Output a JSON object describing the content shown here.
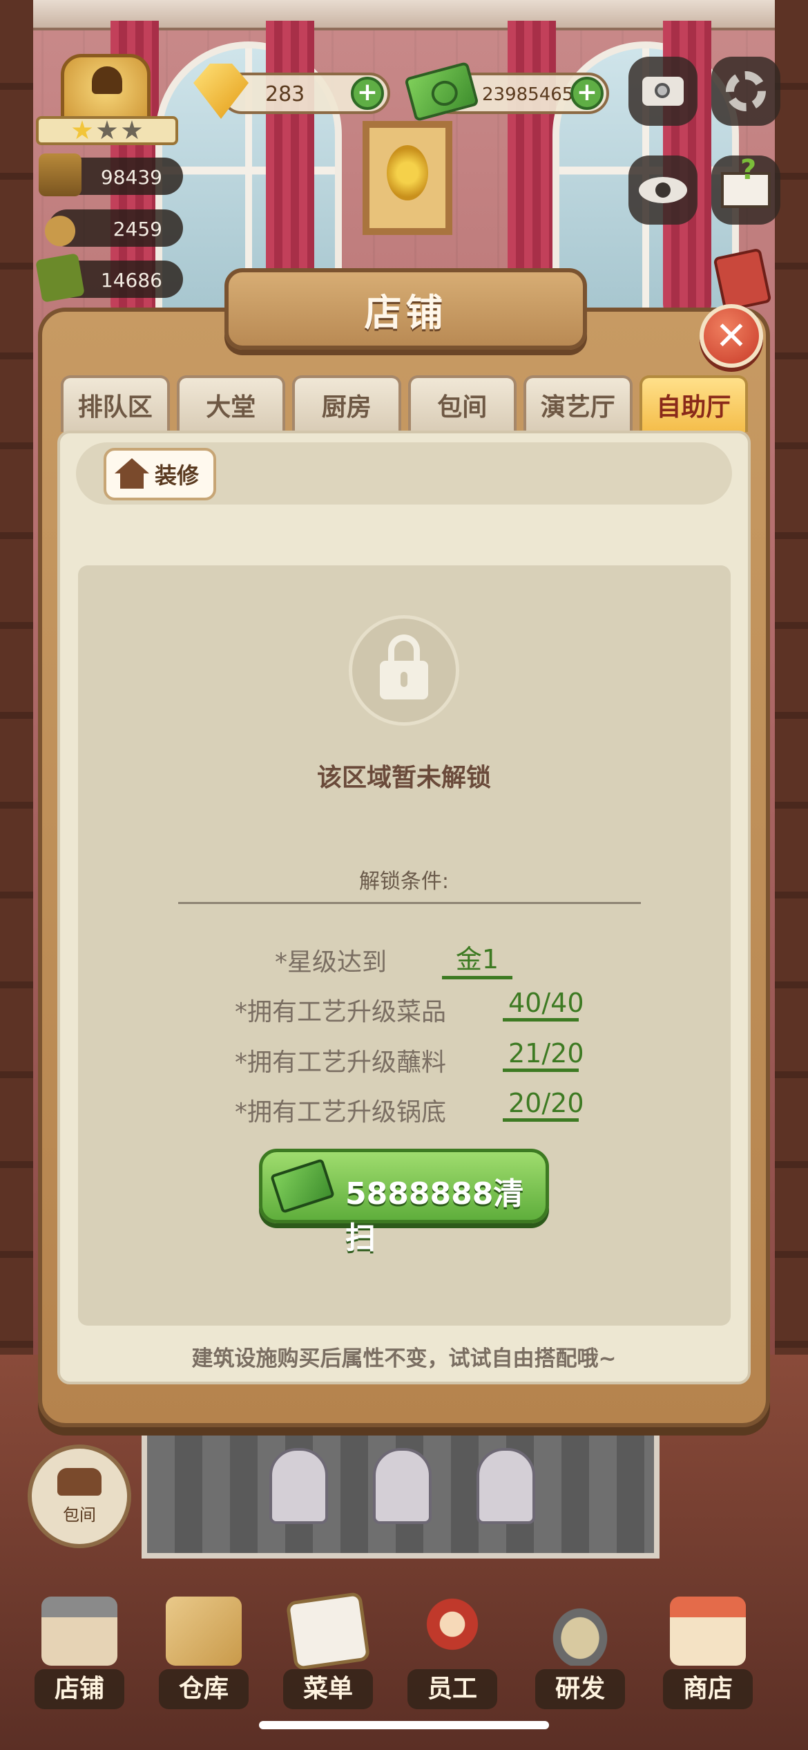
{
  "hud": {
    "stars_filled": 1,
    "stars_total": 3,
    "stats": [
      {
        "icon": "chef-trophy-icon",
        "value": "98439"
      },
      {
        "icon": "cloche-icon",
        "value": "2459"
      },
      {
        "icon": "menu-book-icon",
        "value": "14686"
      }
    ],
    "gems": "283",
    "cash": "23985465"
  },
  "modal": {
    "title": "店铺",
    "tabs": [
      "排队区",
      "大堂",
      "厨房",
      "包间",
      "演艺厅",
      "自助厅"
    ],
    "active_tab": "自助厅",
    "decor_label": "装修",
    "locked_text": "该区域暂未解锁",
    "conditions_title": "解锁条件:",
    "conditions": [
      {
        "label": "*星级达到",
        "value": "金1"
      },
      {
        "label": "*拥有工艺升级菜品",
        "value": "40/40"
      },
      {
        "label": "*拥有工艺升级蘸料",
        "value": "21/20"
      },
      {
        "label": "*拥有工艺升级锅底",
        "value": "20/20"
      }
    ],
    "sweep_button": "5888888清扫",
    "footnote": "建筑设施购买后属性不变，试试自由搭配哦~"
  },
  "private_room_label": "包间",
  "nav": [
    "店铺",
    "仓库",
    "菜单",
    "员工",
    "研发",
    "商店"
  ],
  "colors": {
    "accent_green": "#3d7a22",
    "active_tab": "#f4bd4a",
    "close_red": "#c83a28"
  }
}
